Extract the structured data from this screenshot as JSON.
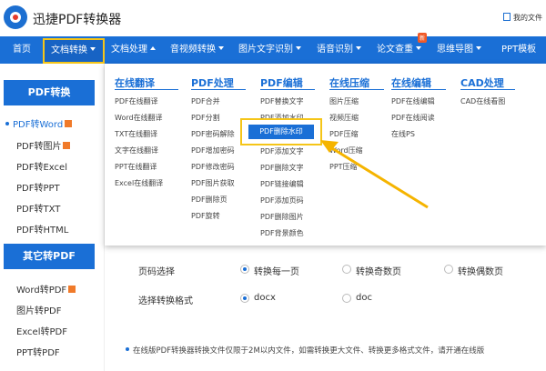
{
  "header": {
    "brand": "迅捷PDF转换器",
    "my_docs": "我的文件"
  },
  "nav": {
    "items": [
      {
        "label": "首页"
      },
      {
        "label": "文档转换"
      },
      {
        "label": "文档处理"
      },
      {
        "label": "音视频转换"
      },
      {
        "label": "图片文字识别"
      },
      {
        "label": "语音识别"
      },
      {
        "label": "论文查重"
      },
      {
        "label": "思维导图"
      },
      {
        "label": "PPT模板"
      }
    ],
    "new_badge": "新"
  },
  "sidebar": {
    "section1_title": "PDF转换",
    "section1_items": [
      "PDF转Word",
      "PDF转图片",
      "PDF转Excel",
      "PDF转PPT",
      "PDF转TXT",
      "PDF转HTML"
    ],
    "section2_title": "其它转PDF",
    "section2_items": [
      "Word转PDF",
      "图片转PDF",
      "Excel转PDF",
      "PPT转PDF"
    ]
  },
  "dropdown": {
    "columns": [
      {
        "title": "在线翻译",
        "items": [
          "PDF在线翻译",
          "Word在线翻译",
          "TXT在线翻译",
          "文字在线翻译",
          "PPT在线翻译",
          "Excel在线翻译"
        ]
      },
      {
        "title": "PDF处理",
        "items": [
          "PDF合并",
          "PDF分割",
          "PDF密码解除",
          "PDF增加密码",
          "PDF修改密码",
          "PDF图片获取",
          "PDF删除页",
          "PDF旋转"
        ]
      },
      {
        "title": "PDF编辑",
        "items": [
          "PDF替换文字",
          "PDF添加水印",
          "PDF删除水印",
          "PDF添加文字",
          "PDF删除文字",
          "PDF链接编辑",
          "PDF添加页码",
          "PDF删除图片",
          "PDF背景颜色"
        ]
      },
      {
        "title": "在线压缩",
        "items": [
          "图片压缩",
          "视频压缩",
          "PDF压缩",
          "Word压缩",
          "PPT压缩"
        ]
      },
      {
        "title": "在线编辑",
        "items": [
          "PDF在线编辑",
          "PDF在线阅读",
          "在线PS"
        ]
      },
      {
        "title": "CAD处理",
        "items": [
          "CAD在线看图"
        ]
      }
    ]
  },
  "main": {
    "page_select_label": "页码选择",
    "page_options": [
      "转换每一页",
      "转换奇数页",
      "转换偶数页"
    ],
    "format_label": "选择转换格式",
    "format_options": [
      "docx",
      "doc"
    ],
    "notice": "在线版PDF转换器转换文件仅限于2M以内文件，如需转换更大文件、转换更多格式文件，请开通在线版"
  },
  "colors": {
    "brand_blue": "#1a6fd6",
    "highlight_yellow": "#f5c518",
    "badge_orange": "#f05a28"
  }
}
